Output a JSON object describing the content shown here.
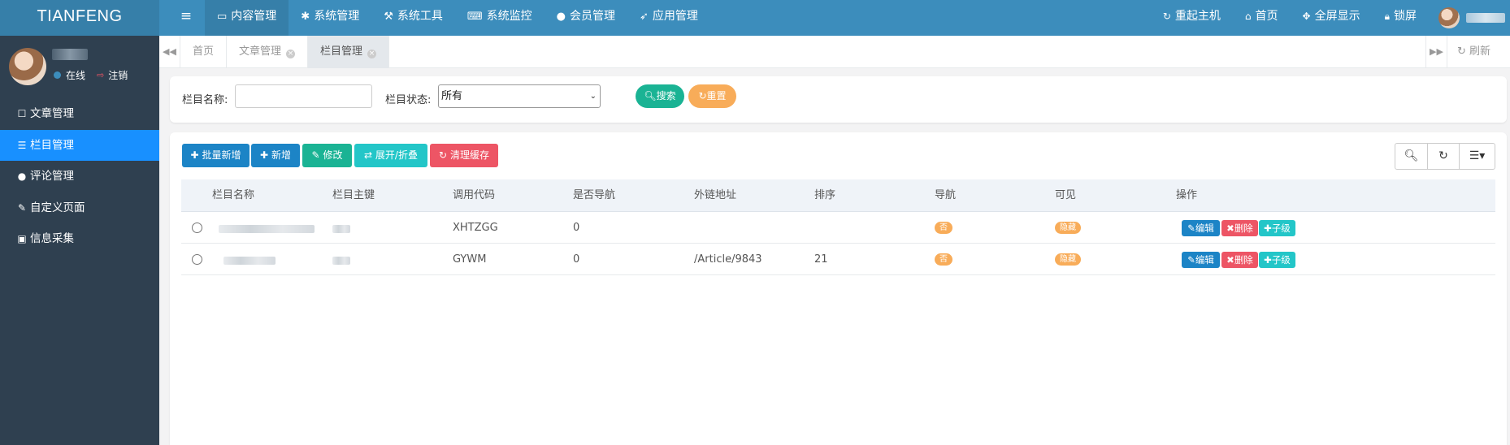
{
  "brand": "TIANFENG",
  "topnav": {
    "toggle_icon": "bars-icon",
    "items": [
      {
        "label": "内容管理",
        "icon": "monitor-icon",
        "active": true
      },
      {
        "label": "系统管理",
        "icon": "gear-icon"
      },
      {
        "label": "系统工具",
        "icon": "gavel-icon"
      },
      {
        "label": "系统监控",
        "icon": "keyboard-icon"
      },
      {
        "label": "会员管理",
        "icon": "user-icon"
      },
      {
        "label": "应用管理",
        "icon": "rocket-icon"
      }
    ],
    "right": [
      {
        "label": "重起主机",
        "icon": "refresh-icon"
      },
      {
        "label": "首页",
        "icon": "home-icon"
      },
      {
        "label": "全屏显示",
        "icon": "arrows-icon"
      },
      {
        "label": "锁屏",
        "icon": "lock-icon"
      }
    ]
  },
  "sidebar": {
    "status_online": "在线",
    "logout": "注销",
    "items": [
      {
        "label": "文章管理",
        "icon": "edit-icon"
      },
      {
        "label": "栏目管理",
        "icon": "list-icon",
        "active": true
      },
      {
        "label": "评论管理",
        "icon": "comment-icon"
      },
      {
        "label": "自定义页面",
        "icon": "edit-icon"
      },
      {
        "label": "信息采集",
        "icon": "bus-icon"
      }
    ]
  },
  "tabs": {
    "items": [
      {
        "label": "首页"
      },
      {
        "label": "文章管理",
        "closable": true
      },
      {
        "label": "栏目管理",
        "closable": true,
        "active": true
      }
    ],
    "refresh": "刷新"
  },
  "search": {
    "name_label": "栏目名称:",
    "name_value": "",
    "status_label": "栏目状态:",
    "status_value": "所有",
    "search_btn": "搜索",
    "reset_btn": "重置"
  },
  "toolbar": {
    "batch_add": "批量新增",
    "add": "新增",
    "edit": "修改",
    "expand": "展开/折叠",
    "clear_cache": "清理缓存"
  },
  "table": {
    "columns": [
      "栏目名称",
      "栏目主键",
      "调用代码",
      "是否导航",
      "外链地址",
      "排序",
      "导航",
      "可见",
      "操作"
    ],
    "rows": [
      {
        "code": "XHTZGG",
        "is_nav": "0",
        "url": "",
        "sort": "",
        "nav": "否",
        "visible": "隐藏"
      },
      {
        "code": "GYWM",
        "is_nav": "0",
        "url": "/Article/9843",
        "sort": "21",
        "nav": "否",
        "visible": "隐藏"
      }
    ],
    "actions": {
      "edit": "编辑",
      "delete": "删除",
      "child": "子级"
    }
  },
  "colors": {
    "topbar": "#3c8dbc",
    "sidebar": "#2f4050",
    "sidebar_active": "#1890ff",
    "primary": "#1c84c6",
    "success": "#1ab394",
    "info": "#23c6c8",
    "danger": "#ed5565",
    "warning": "#f8ac59"
  }
}
